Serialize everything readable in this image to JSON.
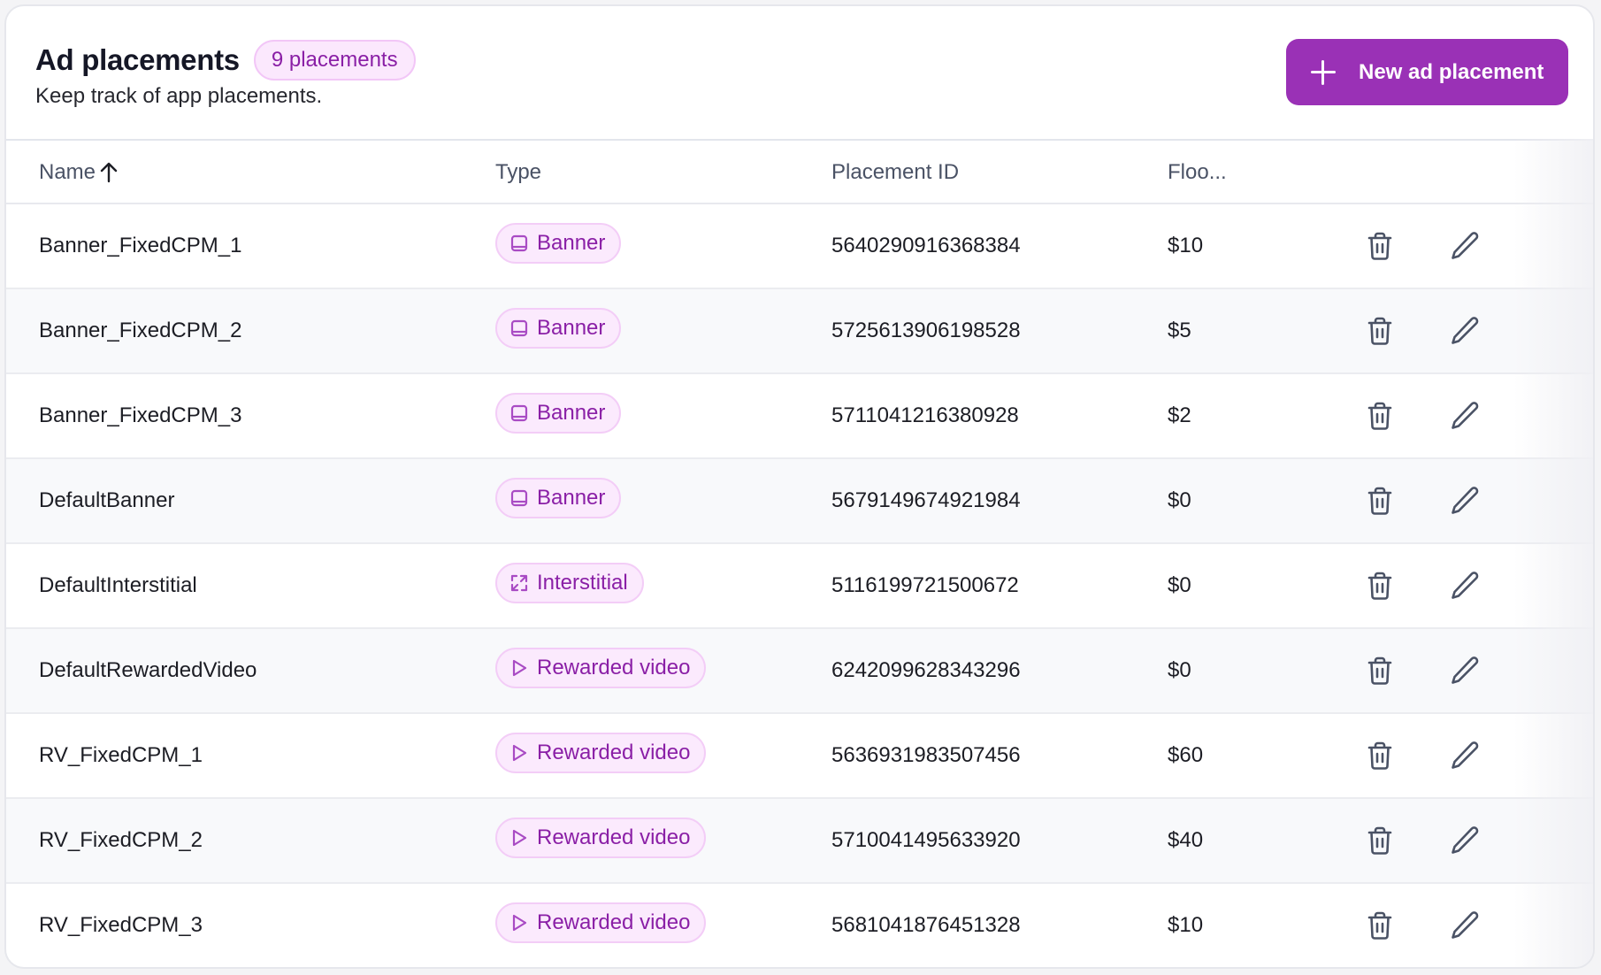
{
  "header": {
    "title": "Ad placements",
    "count_badge": "9 placements",
    "subtitle": "Keep track of app placements.",
    "new_button_label": "New ad placement"
  },
  "colors": {
    "accent": "#9a31b6",
    "badge_bg": "#fbeafd",
    "badge_border": "#f3cdf7",
    "badge_text": "#8a1fa6",
    "icon_gray": "#4a5265"
  },
  "table": {
    "columns": [
      {
        "label": "Name",
        "sort": "ascending",
        "sort_icon": "arrow-up-icon"
      },
      {
        "label": "Type"
      },
      {
        "label": "Placement ID"
      },
      {
        "label": "Floo..."
      }
    ],
    "rows": [
      {
        "name": "Banner_FixedCPM_1",
        "type": "Banner",
        "type_icon": "banner-icon",
        "placement_id": "5640290916368384",
        "floor": "$10"
      },
      {
        "name": "Banner_FixedCPM_2",
        "type": "Banner",
        "type_icon": "banner-icon",
        "placement_id": "5725613906198528",
        "floor": "$5"
      },
      {
        "name": "Banner_FixedCPM_3",
        "type": "Banner",
        "type_icon": "banner-icon",
        "placement_id": "5711041216380928",
        "floor": "$2"
      },
      {
        "name": "DefaultBanner",
        "type": "Banner",
        "type_icon": "banner-icon",
        "placement_id": "5679149674921984",
        "floor": "$0"
      },
      {
        "name": "DefaultInterstitial",
        "type": "Interstitial",
        "type_icon": "expand-icon",
        "placement_id": "5116199721500672",
        "floor": "$0"
      },
      {
        "name": "DefaultRewardedVideo",
        "type": "Rewarded video",
        "type_icon": "play-icon",
        "placement_id": "6242099628343296",
        "floor": "$0"
      },
      {
        "name": "RV_FixedCPM_1",
        "type": "Rewarded video",
        "type_icon": "play-icon",
        "placement_id": "5636931983507456",
        "floor": "$60"
      },
      {
        "name": "RV_FixedCPM_2",
        "type": "Rewarded video",
        "type_icon": "play-icon",
        "placement_id": "5710041495633920",
        "floor": "$40"
      },
      {
        "name": "RV_FixedCPM_3",
        "type": "Rewarded video",
        "type_icon": "play-icon",
        "placement_id": "5681041876451328",
        "floor": "$10"
      }
    ],
    "row_actions": [
      "trash-icon",
      "pencil-icon"
    ]
  }
}
